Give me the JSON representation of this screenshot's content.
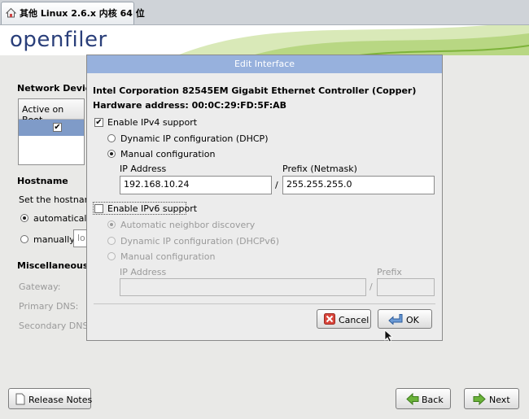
{
  "tab": {
    "title": "其他 Linux 2.6.x 内核 64 位"
  },
  "header": {
    "logo": "openfiler"
  },
  "left": {
    "network_devices_label": "Network Devices",
    "active_on_boot_header": "Active on Boot",
    "hostname_label": "Hostname",
    "set_hostname_text": "Set the hostnam",
    "automatically_label": "automatically",
    "manually_label": "manually",
    "manual_input_value": "lo",
    "misc_label": "Miscellaneous S",
    "gateway_label": "Gateway:",
    "primary_dns_label": "Primary DNS:",
    "secondary_dns_label": "Secondary DNS"
  },
  "dialog": {
    "title": "Edit Interface",
    "device_name": "Intel Corporation 82545EM Gigabit Ethernet Controller (Copper)",
    "hardware_address": "Hardware address: 00:0C:29:FD:5F:AB",
    "ipv4": {
      "enable_label": "Enable IPv4 support",
      "dhcp_label": "Dynamic IP configuration (DHCP)",
      "manual_label": "Manual configuration",
      "ip_label": "IP Address",
      "prefix_label": "Prefix (Netmask)",
      "ip_value": "192.168.10.24",
      "prefix_value": "255.255.255.0",
      "separator": "/"
    },
    "ipv6": {
      "enable_label": "Enable IPv6 support",
      "auto_label": "Automatic neighbor discovery",
      "dhcp_label": "Dynamic IP configuration (DHCPv6)",
      "manual_label": "Manual configuration",
      "ip_label": "IP Address",
      "prefix_label": "Prefix",
      "separator": "/"
    },
    "cancel_label": "Cancel",
    "ok_label": "OK"
  },
  "footer": {
    "release_notes_label": "Release Notes",
    "back_label": "Back",
    "next_label": "Next"
  },
  "colors": {
    "dialog_title_bg": "#97b1dd",
    "header_bar": "#2e5f93",
    "logo": "#2a3f7a",
    "selected_row": "#7f9bc8"
  }
}
